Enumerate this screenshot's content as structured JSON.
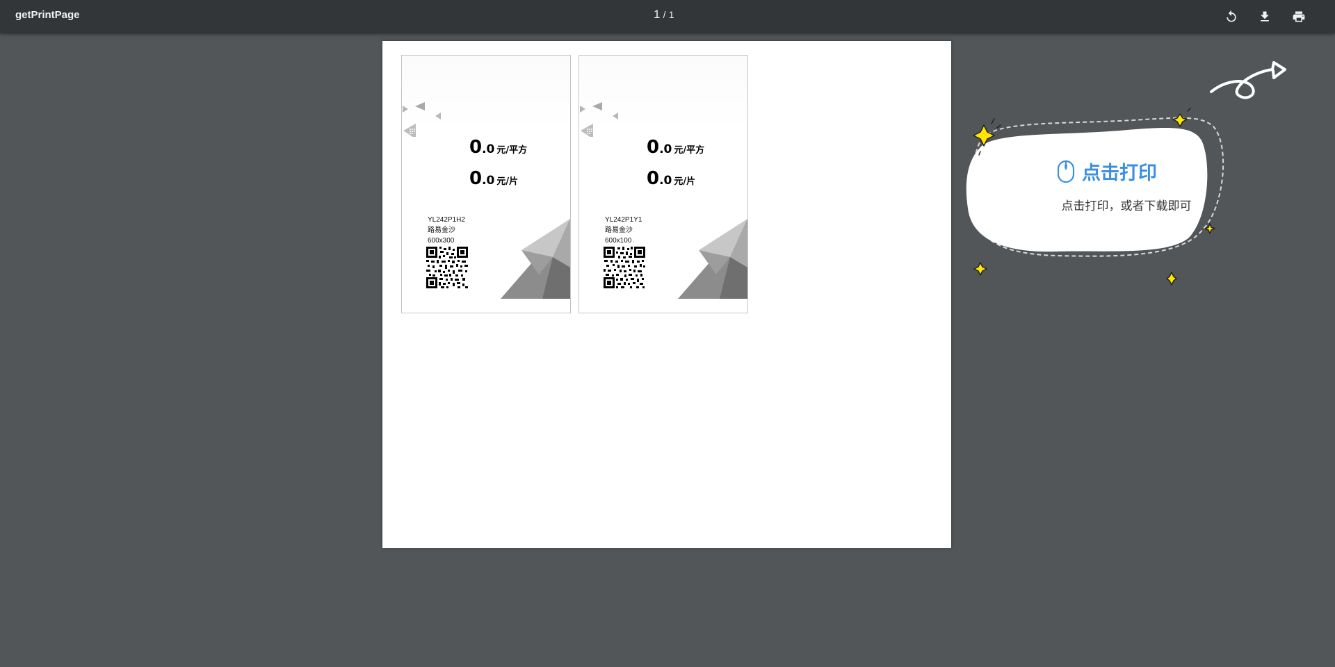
{
  "toolbar": {
    "title": "getPrintPage",
    "page_current": "1",
    "page_separator": "/",
    "page_total": "1",
    "rotate_icon": "rotate-icon",
    "download_icon": "download-icon",
    "print_icon": "print-icon"
  },
  "cards": [
    {
      "price1_int": "0",
      "price1_dec": ".0",
      "price1_unit": "元/平方",
      "price2_int": "0",
      "price2_dec": ".0",
      "price2_unit": "元/片",
      "code": "YL242P1H2",
      "name": "路易金沙",
      "size": "600x300"
    },
    {
      "price1_int": "0",
      "price1_dec": ".0",
      "price1_unit": "元/平方",
      "price2_int": "0",
      "price2_dec": ".0",
      "price2_unit": "元/片",
      "code": "YL242P1Y1",
      "name": "路易金沙",
      "size": "600x100"
    }
  ],
  "guide": {
    "title": "点击打印",
    "subtitle": "点击打印，或者下载即可",
    "icon": "mouse-icon",
    "accent": "#3b8fe0",
    "sparkle_color": "#ffe600"
  },
  "colors": {
    "toolbar": "#323639",
    "viewer_background": "#525659",
    "page": "#ffffff"
  }
}
